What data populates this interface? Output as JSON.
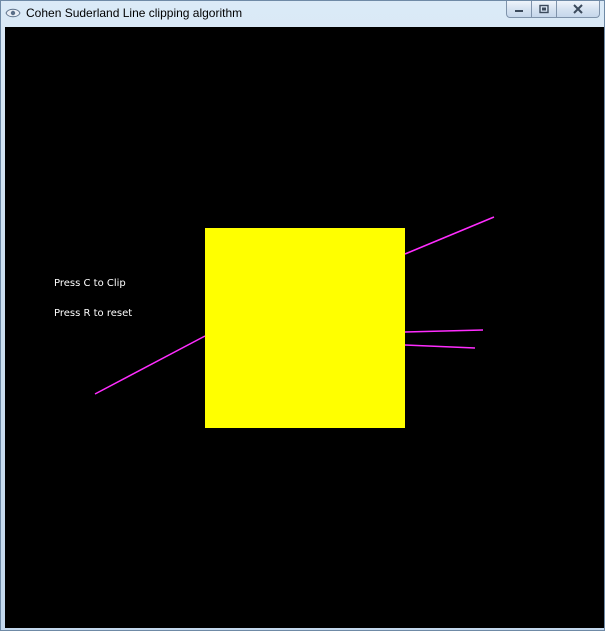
{
  "window": {
    "title": "Cohen Suderland Line clipping algorithm",
    "icon": "app-icon",
    "controls": [
      "minimize-icon",
      "restore-icon",
      "close-icon"
    ]
  },
  "canvas": {
    "background": "#000000",
    "instructions": {
      "clip": "Press C to Clip",
      "reset": "Press R to reset"
    },
    "clip_window": {
      "color": "#ffff00"
    },
    "line_color": "#ff2dff"
  }
}
